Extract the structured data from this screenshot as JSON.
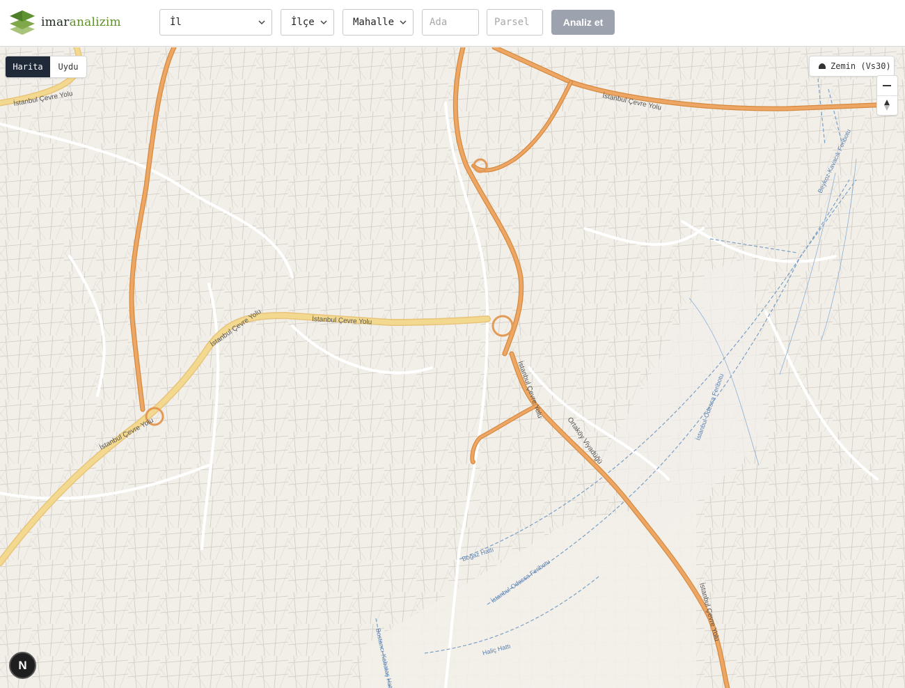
{
  "brand": {
    "name_main": "imar",
    "name_accent": "analizim"
  },
  "search": {
    "il_label": "İl",
    "ilce_label": "İlçe",
    "mahalle_label": "Mahalle",
    "ada_placeholder": "Ada",
    "parsel_placeholder": "Parsel",
    "analyze_label": "Analiz et"
  },
  "map_toggle": {
    "map_label": "Harita",
    "satellite_label": "Uydu",
    "selected": "Harita"
  },
  "layer_button": {
    "label": "Zemin (Vs30)",
    "icon": "layers-icon"
  },
  "controls": {
    "zoom_out": "minus-icon",
    "compass": "compass-icon"
  },
  "badge": {
    "letter": "N"
  },
  "map_labels": {
    "cevre_yolu": "İstanbul Çevre Yolu",
    "cevre_yolu_short": "İstanbul Çevre Yolu",
    "ortakoy": "Ortaköy Viyadüğü",
    "bogaz_hatti": "Boğaz Hattı",
    "ferry1": "İstanbul-Odessa Feribotu",
    "ferry2": "İstanbul-Odessa Feribotu",
    "ferry3": "Beykoz-Kavacık Feribotu",
    "halic": "Haliç Hattı",
    "kabatas": "Bostancı-Kabataş Hattı"
  },
  "colors": {
    "motorway": "#e9a25b",
    "motorway_casing": "#d48a3f",
    "trunk": "#f1d28a",
    "background": "#f2efe9",
    "water_route": "#7a9fc4",
    "accent_green": "#5f8f2a"
  }
}
